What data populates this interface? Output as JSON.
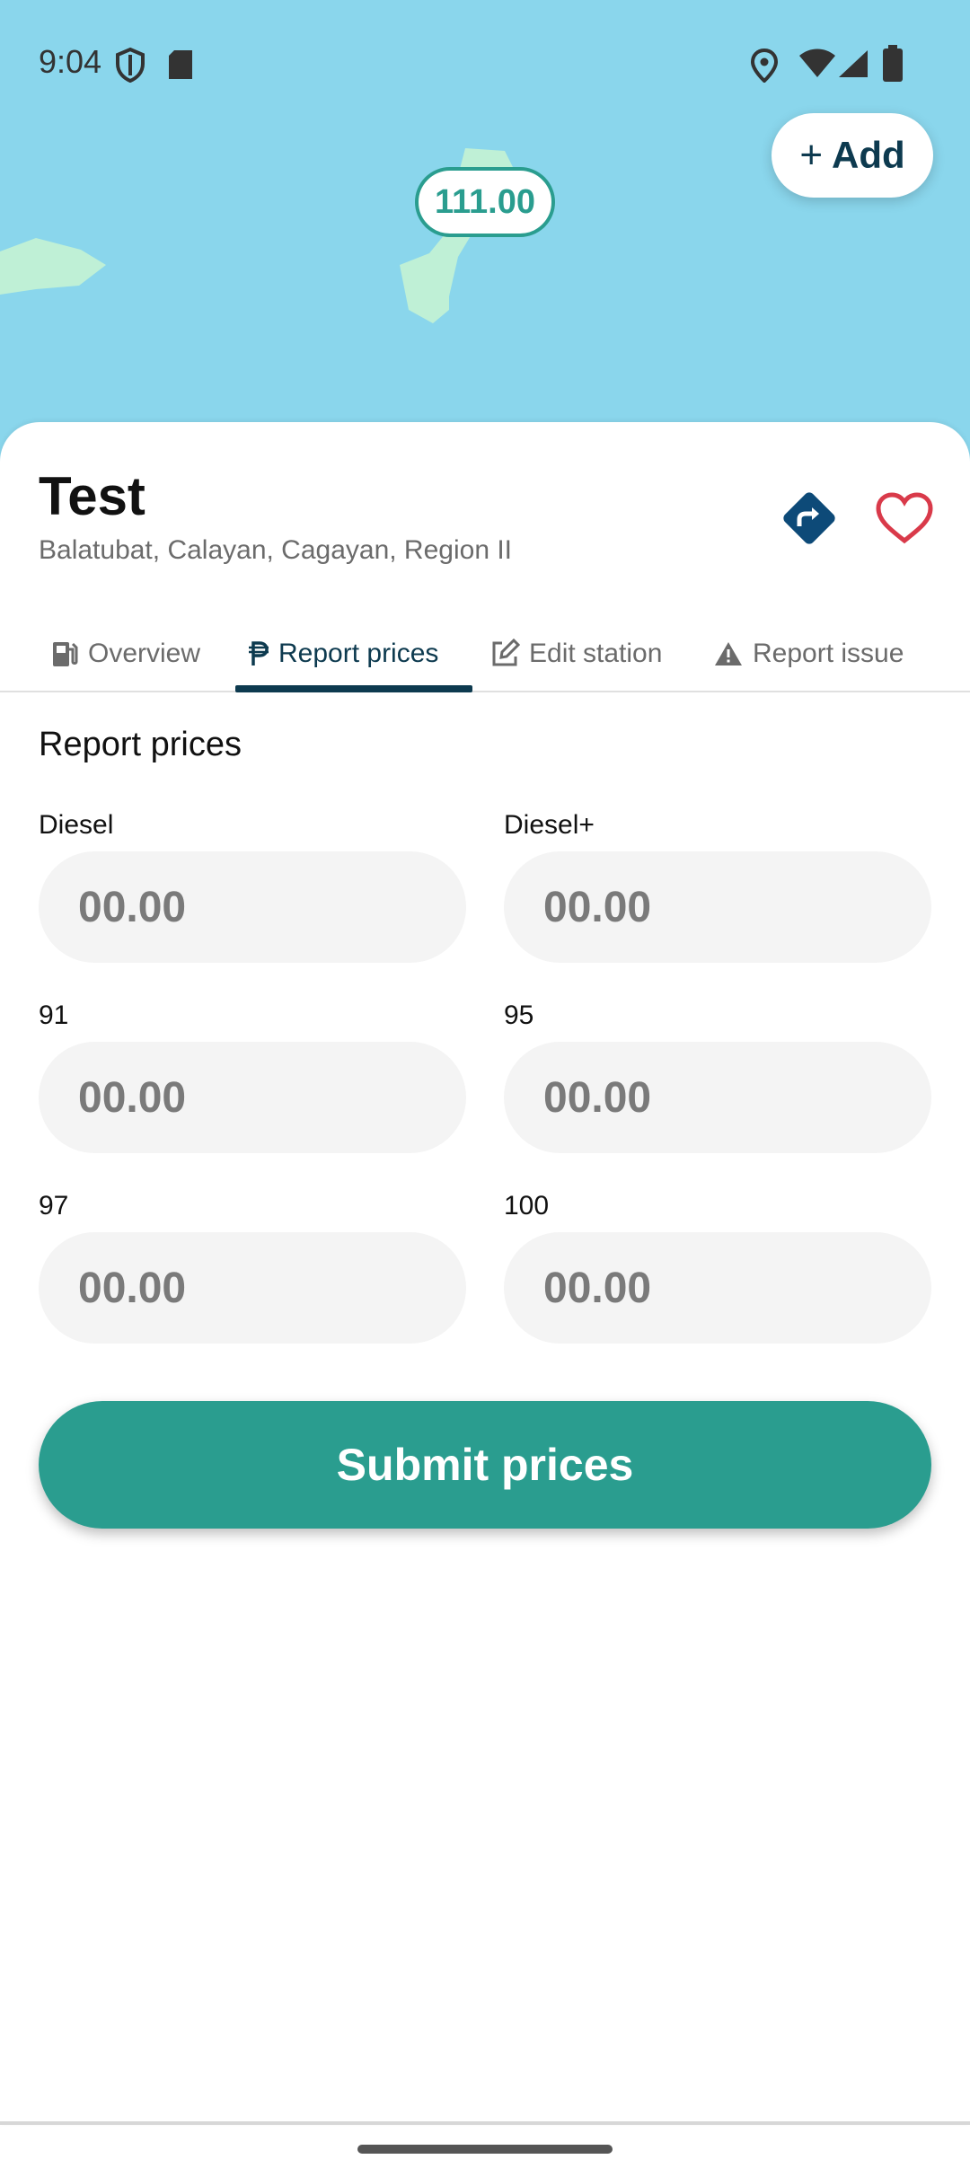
{
  "status_bar": {
    "time": "9:04"
  },
  "map": {
    "add_button_label": "Add",
    "marker_price": "111.00"
  },
  "station": {
    "name": "Test",
    "address": "Balatubat, Calayan, Cagayan, Region II"
  },
  "tabs": [
    {
      "label": "Overview",
      "icon": "fuel-pump-icon"
    },
    {
      "label": "Report prices",
      "icon": "peso-icon",
      "active": true
    },
    {
      "label": "Edit station",
      "icon": "edit-icon"
    },
    {
      "label": "Report issue",
      "icon": "warning-icon"
    }
  ],
  "form": {
    "title": "Report prices",
    "fields": [
      {
        "label": "Diesel",
        "placeholder": "00.00"
      },
      {
        "label": "Diesel+",
        "placeholder": "00.00"
      },
      {
        "label": "91",
        "placeholder": "00.00"
      },
      {
        "label": "95",
        "placeholder": "00.00"
      },
      {
        "label": "97",
        "placeholder": "00.00"
      },
      {
        "label": "100",
        "placeholder": "00.00"
      }
    ],
    "submit_label": "Submit prices"
  },
  "colors": {
    "accent": "#2a9d8f",
    "primary_dark": "#0d3a4f",
    "map_water": "#8ad6ec",
    "map_land": "#bff0d6",
    "favorite": "#d93a4a"
  }
}
